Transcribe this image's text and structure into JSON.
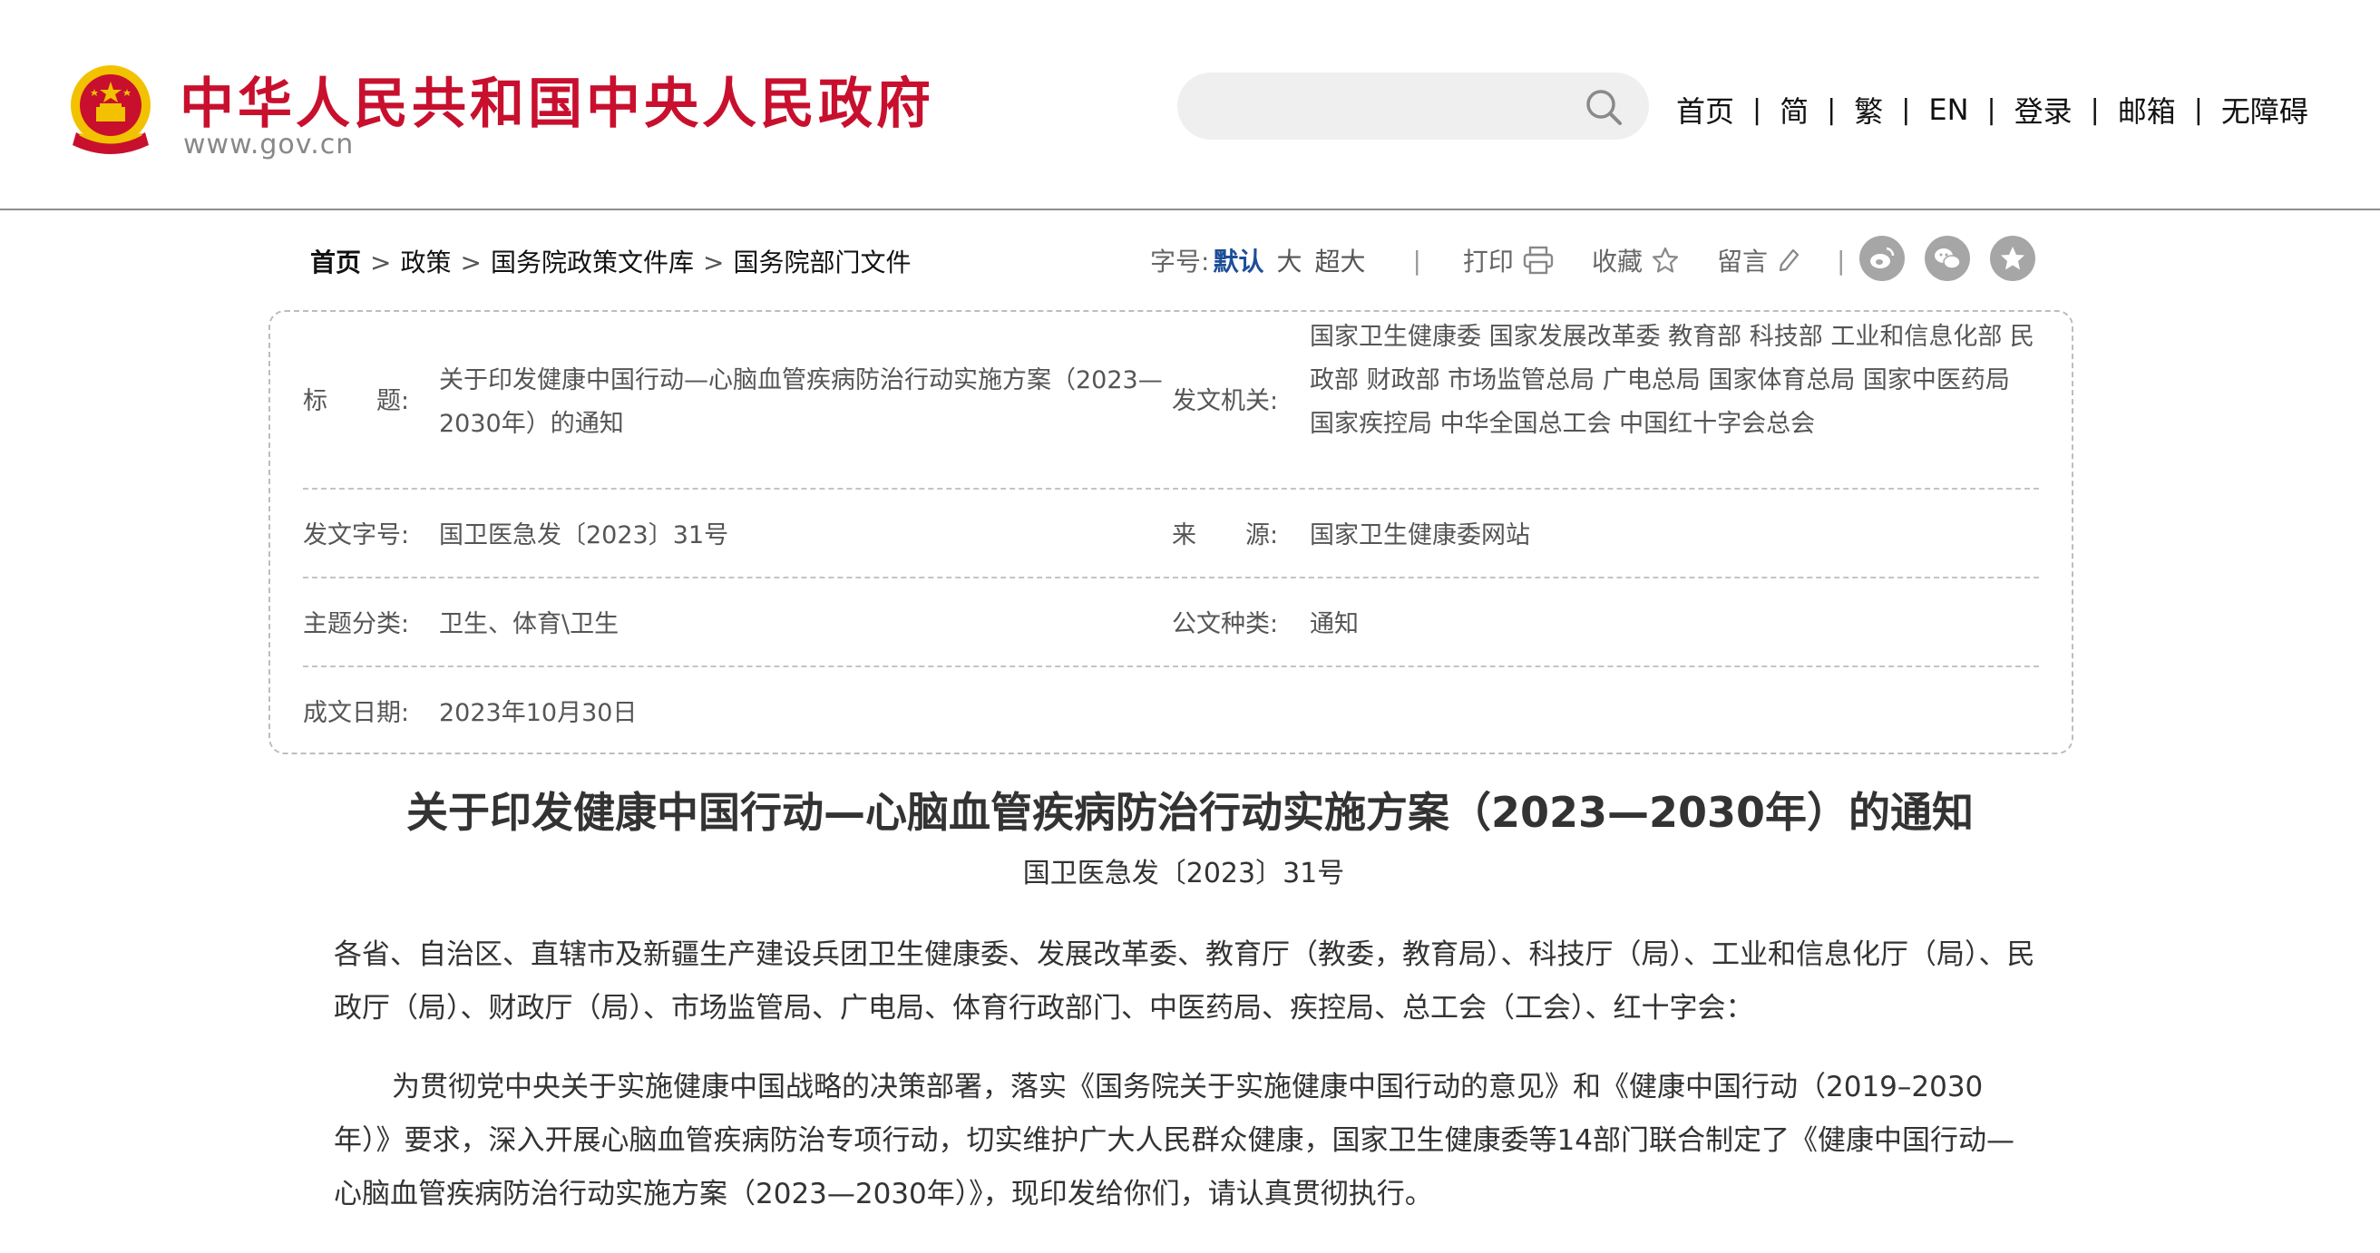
{
  "header": {
    "site_title": "中华人民共和国中央人民政府",
    "site_domain": "www.gov.cn",
    "search": {
      "placeholder": "",
      "value": ""
    },
    "nav": [
      "首页",
      "简",
      "繁",
      "EN",
      "登录",
      "邮箱",
      "无障碍"
    ],
    "nav_separator": "|"
  },
  "breadcrumb": {
    "items": [
      "首页",
      "政策",
      "国务院政策文件库",
      "国务院部门文件"
    ],
    "separator": ">"
  },
  "toolbar": {
    "font_size_label": "字号:",
    "font_sizes": [
      "默认",
      "大",
      "超大"
    ],
    "divider": "|",
    "print_label": "打印",
    "favorite_label": "收藏",
    "comment_label": "留言",
    "share_icons": [
      "weibo-icon",
      "wechat-icon",
      "qzone-icon"
    ]
  },
  "meta": {
    "title_label": "标　　题:",
    "title_value": "关于印发健康中国行动—心脑血管疾病防治行动实施方案（2023—2030年）的通知",
    "issuer_label": "发文机关:",
    "issuer_value": "国家卫生健康委  国家发展改革委  教育部  科技部  工业和信息化部  民政部  财政部  市场监管总局  广电总局  国家体育总局  国家中医药局  国家疾控局  中华全国总工会  中国红十字会总会",
    "doc_no_label": "发文字号:",
    "doc_no_value": "国卫医急发〔2023〕31号",
    "source_label": "来　　源:",
    "source_value": "国家卫生健康委网站",
    "category_label": "主题分类:",
    "category_value": "卫生、体育\\卫生",
    "doc_type_label": "公文种类:",
    "doc_type_value": "通知",
    "date_label": "成文日期:",
    "date_value": "2023年10月30日"
  },
  "article": {
    "title": "关于印发健康中国行动—心脑血管疾病防治行动实施方案（2023—2030年）的通知",
    "doc_no": "国卫医急发〔2023〕31号",
    "addressee": "各省、自治区、直辖市及新疆生产建设兵团卫生健康委、发展改革委、教育厅（教委，教育局）、科技厅（局）、工业和信息化厅（局）、民政厅（局）、财政厅（局）、市场监管局、广电局、体育行政部门、中医药局、疾控局、总工会（工会）、红十字会：",
    "paragraph1": "为贯彻党中央关于实施健康中国战略的决策部署，落实《国务院关于实施健康中国行动的意见》和《健康中国行动（2019–2030年）》要求，深入开展心脑血管疾病防治专项行动，切实维护广大人民群众健康，国家卫生健康委等14部门联合制定了《健康中国行动—心脑血管疾病防治行动实施方案（2023—2030年）》，现印发给你们，请认真贯彻执行。"
  },
  "colors": {
    "brand_red": "#c8102e",
    "emblem_gold": "#f2c200",
    "link_blue": "#1d4e99",
    "share_gray": "#a6a6a6"
  }
}
